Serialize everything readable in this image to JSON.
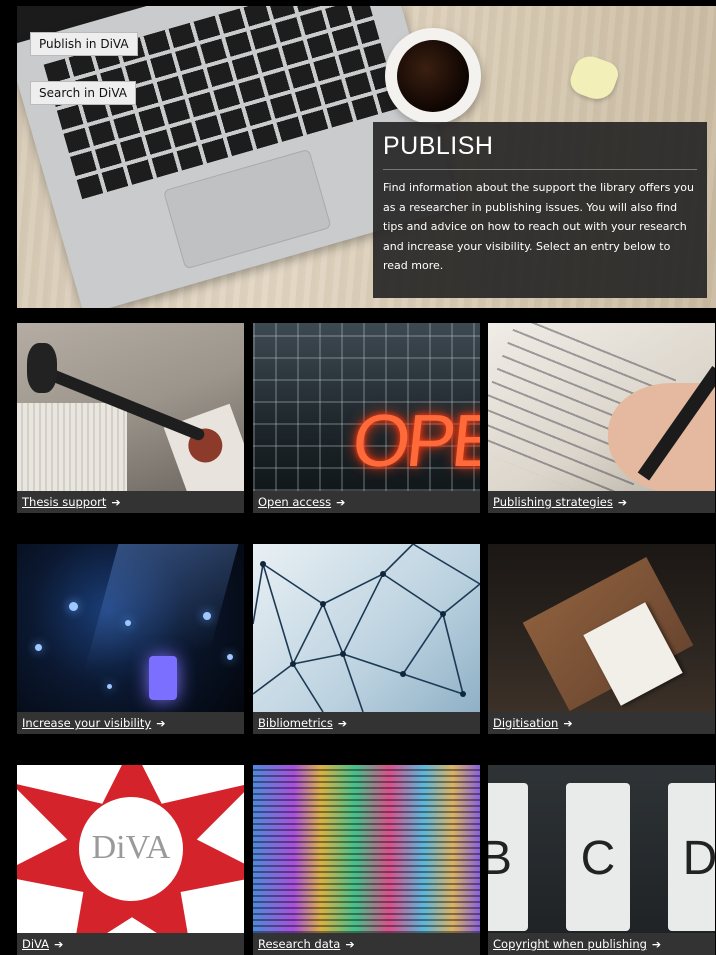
{
  "hero": {
    "buttons": {
      "publish_in_diva": "Publish in DiVA",
      "search_in_diva": "Search in DiVA"
    },
    "panel": {
      "title": "PUBLISH",
      "text": "Find information about the support the library offers you as a researcher in publishing issues. You will also find tips and advice on how to reach out with your research and increase your visibility. Select an entry below to read more."
    }
  },
  "arrow": "➔",
  "tiles": [
    {
      "label": "Thesis support"
    },
    {
      "label": "Open access",
      "sign_text": "OPEN"
    },
    {
      "label": "Publishing strategies"
    },
    {
      "label": "Increase your visibility"
    },
    {
      "label": "Bibliometrics"
    },
    {
      "label": "Digitisation"
    },
    {
      "label": "DiVA",
      "logo_text": "DiVA"
    },
    {
      "label": "Research data"
    },
    {
      "label": "Copyright when publishing",
      "keys": [
        "B",
        "C",
        "D"
      ]
    }
  ],
  "colors": {
    "background": "#000000",
    "caption_bar": "#333333",
    "panel": "#222222",
    "diva_red": "#d4232a"
  }
}
